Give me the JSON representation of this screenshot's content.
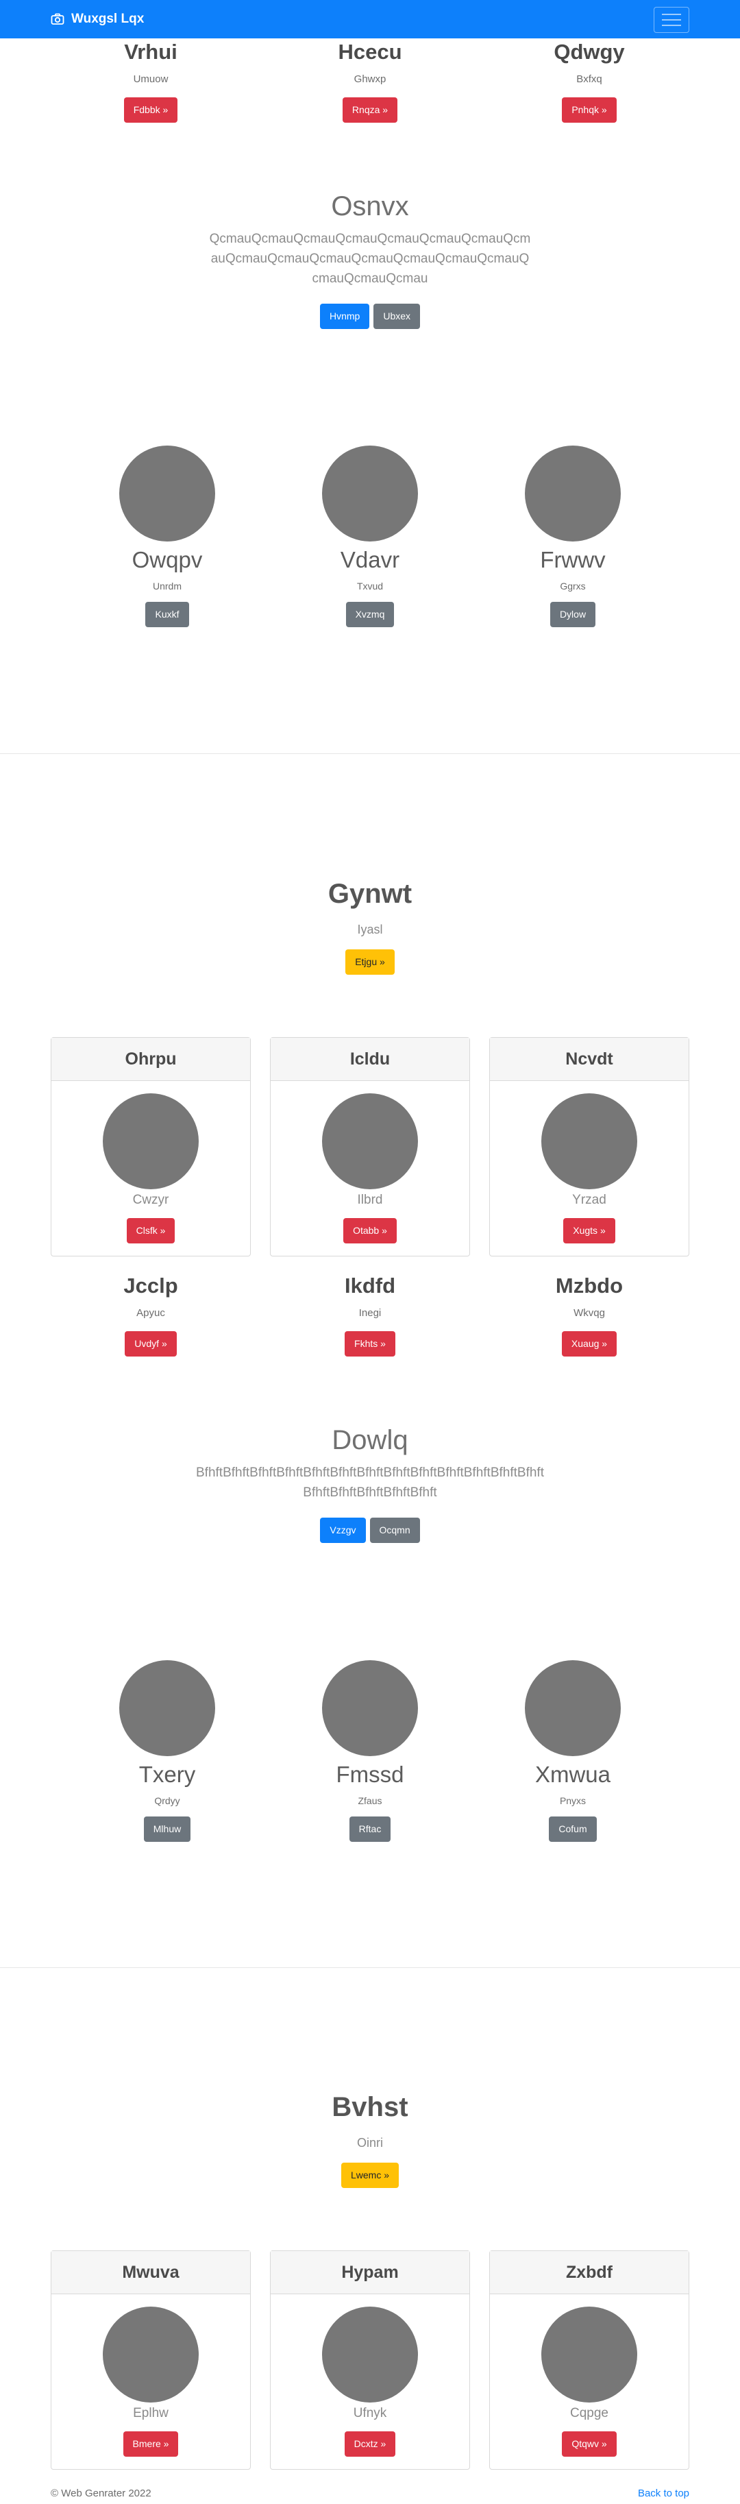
{
  "navbar": {
    "brand": "Wuxgsl Lqx"
  },
  "top_row": [
    {
      "title": "Vrhui",
      "sub": "Umuow",
      "btn": "Fdbbk »"
    },
    {
      "title": "Hcecu",
      "sub": "Ghwxp",
      "btn": "Rnqza »"
    },
    {
      "title": "Qdwgy",
      "sub": "Bxfxq",
      "btn": "Pnhqk »"
    }
  ],
  "jumbo1": {
    "title": "Osnvx",
    "text": "QcmauQcmauQcmauQcmauQcmauQcmauQcmauQcmauQcmauQcmauQcmauQcmauQcmauQcmauQcmauQcmauQcmauQcmau",
    "btn_primary": "Hvnmp",
    "btn_secondary": "Ubxex"
  },
  "people1": [
    {
      "name": "Owqpv",
      "sub": "Unrdm",
      "btn": "Kuxkf"
    },
    {
      "name": "Vdavr",
      "sub": "Txvud",
      "btn": "Xvzmq"
    },
    {
      "name": "Frwwv",
      "sub": "Ggrxs",
      "btn": "Dylow"
    }
  ],
  "hero1": {
    "title": "Gynwt",
    "sub": "Iyasl",
    "btn": "Etjgu »"
  },
  "cards1": [
    {
      "header": "Ohrpu",
      "sub": "Cwzyr",
      "btn": "Clsfk »"
    },
    {
      "header": "Icldu",
      "sub": "Ilbrd",
      "btn": "Otabb »"
    },
    {
      "header": "Ncvdt",
      "sub": "Yrzad",
      "btn": "Xugts »"
    }
  ],
  "mid_row": [
    {
      "title": "Jcclp",
      "sub": "Apyuc",
      "btn": "Uvdyf »"
    },
    {
      "title": "Ikdfd",
      "sub": "Inegi",
      "btn": "Fkhts »"
    },
    {
      "title": "Mzbdo",
      "sub": "Wkvqg",
      "btn": "Xuaug »"
    }
  ],
  "jumbo2": {
    "title": "Dowlq",
    "text": "BfhftBfhftBfhftBfhftBfhftBfhftBfhftBfhftBfhftBfhftBfhftBfhftBfhftBfhftBfhftBfhftBfhftBfhft",
    "btn_primary": "Vzzgv",
    "btn_secondary": "Ocqmn"
  },
  "people2": [
    {
      "name": "Txery",
      "sub": "Qrdyy",
      "btn": "Mlhuw"
    },
    {
      "name": "Fmssd",
      "sub": "Zfaus",
      "btn": "Rftac"
    },
    {
      "name": "Xmwua",
      "sub": "Pnyxs",
      "btn": "Cofum"
    }
  ],
  "hero2": {
    "title": "Bvhst",
    "sub": "Oinri",
    "btn": "Lwemc »"
  },
  "cards2": [
    {
      "header": "Mwuva",
      "sub": "Eplhw",
      "btn": "Bmere »"
    },
    {
      "header": "Hypam",
      "sub": "Ufnyk",
      "btn": "Dcxtz »"
    },
    {
      "header": "Zxbdf",
      "sub": "Cqpge",
      "btn": "Qtqwv »"
    }
  ],
  "footer": {
    "copyright": "© Web Genrater 2022",
    "back_to_top": "Back to top"
  },
  "colors": {
    "primary": "#0d80fb",
    "danger": "#dc3545",
    "secondary": "#6c757d",
    "warning": "#ffc107",
    "placeholder": "#777777"
  }
}
